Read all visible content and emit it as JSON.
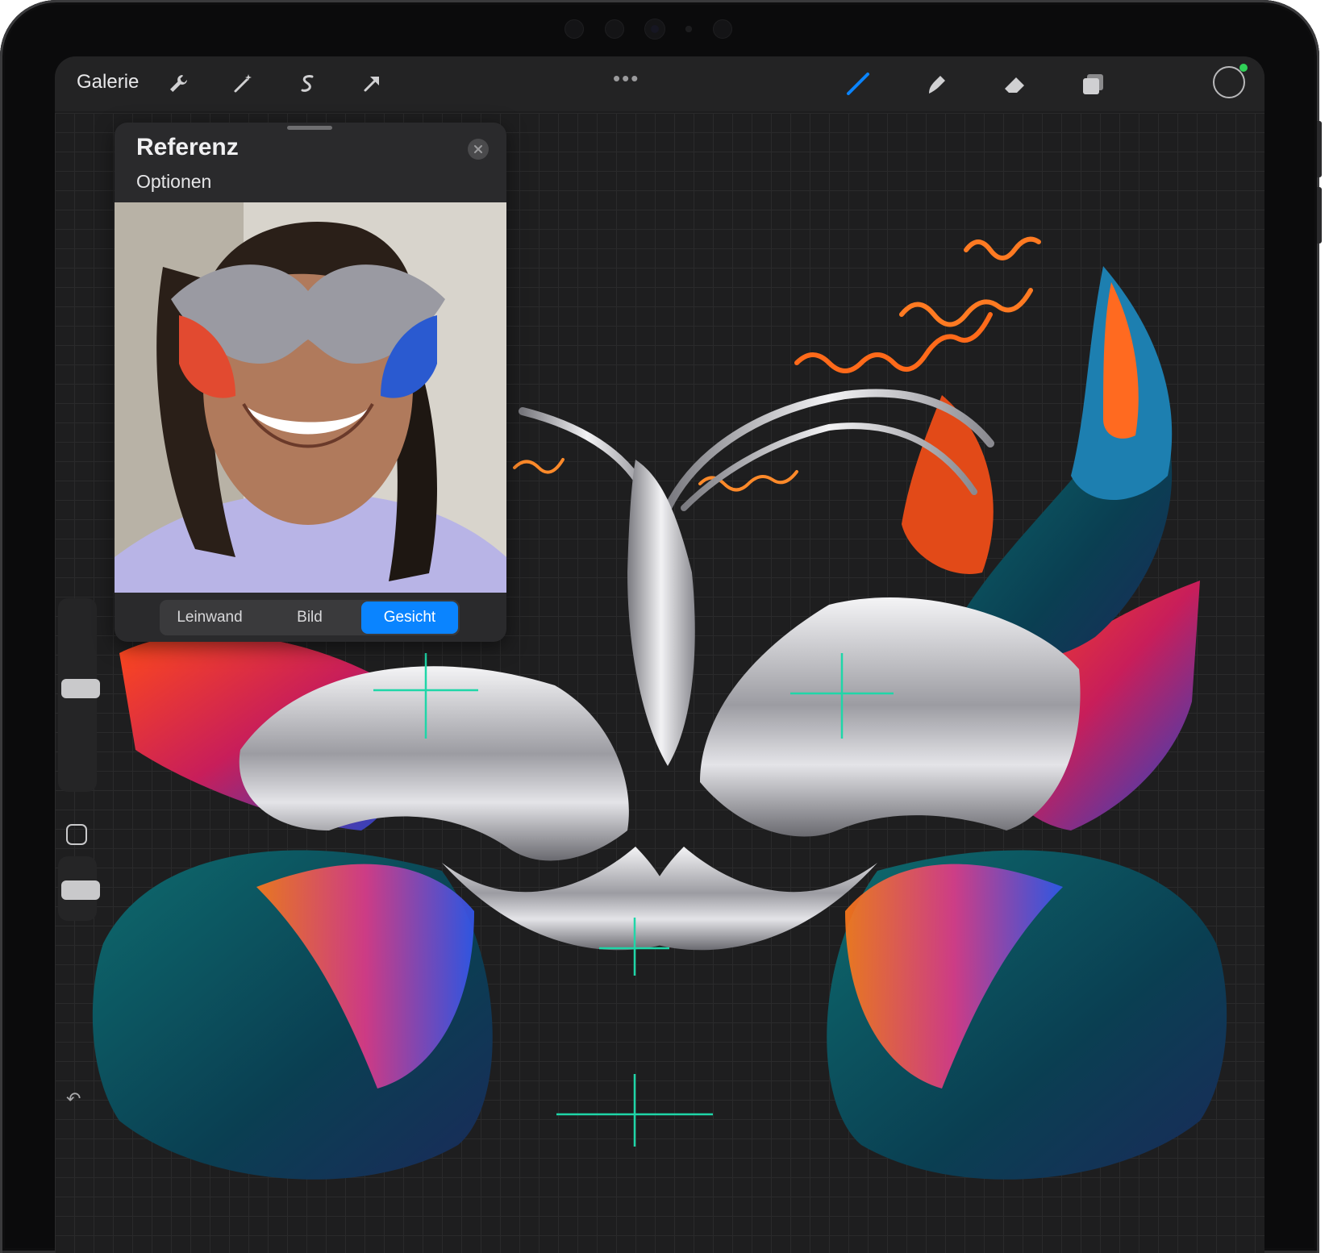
{
  "toolbar": {
    "gallery_label": "Galerie",
    "more_label": "•••",
    "left_icons": [
      "wrench-icon",
      "magic-wand-icon",
      "selection-icon",
      "transform-arrow-icon"
    ],
    "right_icons": [
      "brush-icon",
      "smudge-icon",
      "eraser-icon",
      "layers-icon"
    ],
    "active_tool": "brush-icon",
    "active_color": "#1c1c1d",
    "accent": "#0a84ff"
  },
  "reference": {
    "title": "Referenz",
    "options_label": "Optionen",
    "tabs": [
      {
        "label": "Leinwand",
        "active": false
      },
      {
        "label": "Bild",
        "active": false
      },
      {
        "label": "Gesicht",
        "active": true
      }
    ]
  },
  "sidebar": {
    "undo_icon": "↶"
  },
  "colors": {
    "guide": "#1fd6a8",
    "canvas": "#1e1e1f"
  }
}
